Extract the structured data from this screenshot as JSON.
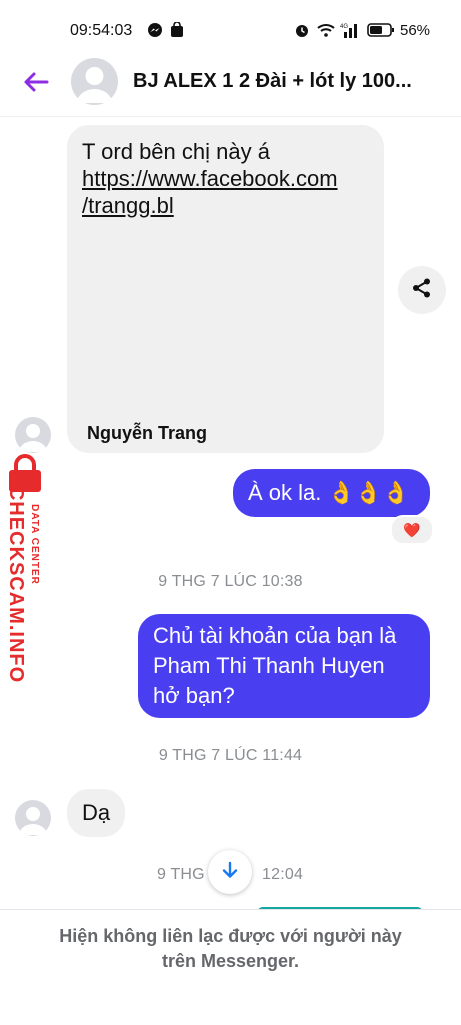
{
  "status_bar": {
    "time": "09:54:03",
    "battery_percent": "56%",
    "network_label": "4G"
  },
  "header": {
    "title": "BJ ALEX 1 2 Đài + lót ly 100..."
  },
  "messages": {
    "link_card": {
      "line1": "T ord bên chị này á",
      "url_line1": "https://www.facebook.com",
      "url_line2": "/trangg.bl",
      "sender_name": "Nguyễn Trang"
    },
    "out1": {
      "text": "À ok la. 👌👌👌",
      "reaction": "❤️"
    },
    "ts1": "9 THG 7 LÚC 10:38",
    "out2": {
      "line1": "Chủ tài khoản của bạn là",
      "line2": "Pham Thi Thanh Huyen",
      "line3": "hở bạn?"
    },
    "ts2": "9 THG 7 LÚC 11:44",
    "in1": {
      "text": "Dạ"
    },
    "ts3_left": "9 THG",
    "ts3_right": "12:04"
  },
  "watermark": {
    "main": "CHECKSCAM.INFO",
    "sub": "DATA CENTER"
  },
  "footer": {
    "line1": "Hiện không liên lạc được với người này",
    "line2": "trên Messenger."
  },
  "colors": {
    "accent": "#8e2de2",
    "outgoing_bubble": "#4a3ff0",
    "incoming_bubble": "#f0f0f0",
    "watermark": "#e52b2b"
  }
}
